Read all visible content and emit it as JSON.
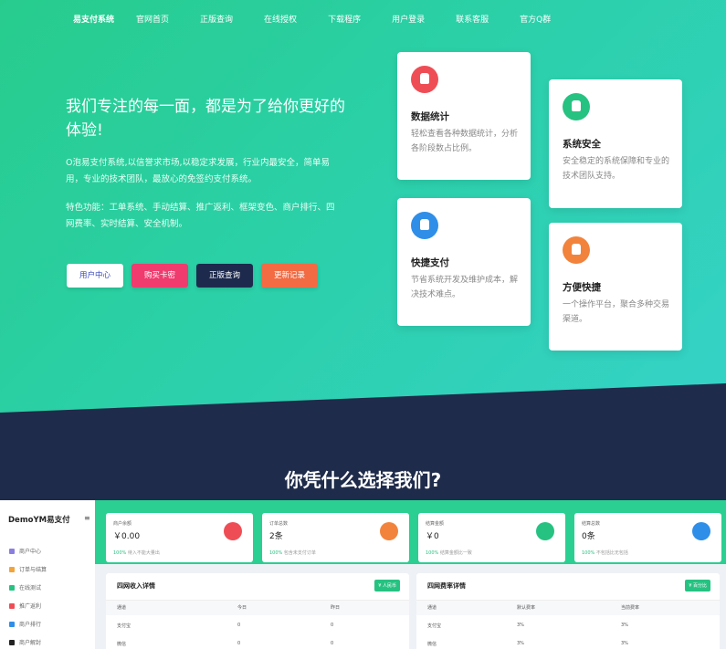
{
  "nav": [
    "易支付系统",
    "官网首页",
    "正版查询",
    "在线授权",
    "下载程序",
    "用户登录",
    "联系客服",
    "官方Q群"
  ],
  "hero": {
    "title": "我们专注的每一面，都是为了给你更好的体验!",
    "desc": "O泡易支付系统,以信誉求市场,以稳定求发展，行业内最安全，简单易用，专业的技术团队，最放心的免签约支付系统。",
    "features": "特色功能：工单系统、手动结算、推广返利、框架变色、商户排行、四网费率、实时结算、安全机制。",
    "buttons": [
      "用户中心",
      "购买卡密",
      "正版查询",
      "更新记录"
    ]
  },
  "cards": [
    {
      "title": "数据统计",
      "desc": "轻松查看各种数据统计，分析各阶段数占比例。",
      "color": "#ef4d55"
    },
    {
      "title": "系统安全",
      "desc": "安全稳定的系统保障和专业的技术团队支持。",
      "color": "#26c281"
    },
    {
      "title": "快捷支付",
      "desc": "节省系统开发及维护成本，解决技术难点。",
      "color": "#2f8ee8"
    },
    {
      "title": "方便快捷",
      "desc": "一个操作平台，聚合多种交易渠道。",
      "color": "#f2833c"
    }
  ],
  "section_title": "你凭什么选择我们?",
  "dashboard": {
    "logo": "DemoYM易支付",
    "menu": [
      {
        "label": "商户中心",
        "color": "#8a7ee0"
      },
      {
        "label": "订单与结算",
        "color": "#f2a43c"
      },
      {
        "label": "在线测试",
        "color": "#26c281"
      },
      {
        "label": "推广返利",
        "color": "#ef4d55"
      },
      {
        "label": "商户排行",
        "color": "#2f8ee8"
      },
      {
        "label": "商户解封",
        "color": "#222222"
      }
    ],
    "stats": [
      {
        "label": "商户余额",
        "value": "￥0.00",
        "rate": "100%",
        "note": "待入不能大量出",
        "color": "#ef4d55"
      },
      {
        "label": "订单总数",
        "value": "2条",
        "rate": "100%",
        "note": "包含未支付订单",
        "color": "#f2833c"
      },
      {
        "label": "结算金额",
        "value": "￥0",
        "rate": "100%",
        "note": "结算金额比一致",
        "color": "#26c281"
      },
      {
        "label": "结算总数",
        "value": "0条",
        "rate": "100%",
        "note": "不包括比无包括",
        "color": "#2f8ee8"
      }
    ],
    "panels": [
      {
        "title": "四网收入详情",
        "tag": "¥ 人民币",
        "headers": [
          "通道",
          "今日",
          "昨日"
        ],
        "rows": [
          [
            "支付宝",
            "0",
            "0"
          ],
          [
            "微信",
            "0",
            "0"
          ]
        ]
      },
      {
        "title": "四网费率详情",
        "tag": "¥ 百分比",
        "headers": [
          "通道",
          "默认费率",
          "当前费率"
        ],
        "rows": [
          [
            "支付宝",
            "3%",
            "3%"
          ],
          [
            "微信",
            "3%",
            "3%"
          ]
        ]
      }
    ]
  }
}
